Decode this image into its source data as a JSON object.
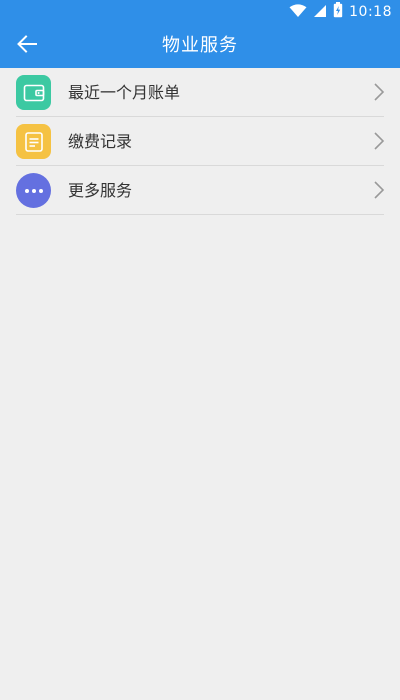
{
  "status_bar": {
    "time": "10:18",
    "icons": [
      "wifi-icon",
      "cell-signal-icon",
      "battery-icon"
    ]
  },
  "toolbar": {
    "back_icon": "arrow-left-icon",
    "title": "物业服务"
  },
  "menu": {
    "items": [
      {
        "label": "最近一个月账单",
        "icon": "wallet-icon",
        "icon_color": "#3cc9a2"
      },
      {
        "label": "缴费记录",
        "icon": "document-icon",
        "icon_color": "#f5c243"
      },
      {
        "label": "更多服务",
        "icon": "more-dots-icon",
        "icon_color": "#6470e0"
      }
    ]
  },
  "colors": {
    "primary": "#2f8fe8",
    "background": "#efefef",
    "divider": "#d9d9d9",
    "text": "#333333"
  }
}
